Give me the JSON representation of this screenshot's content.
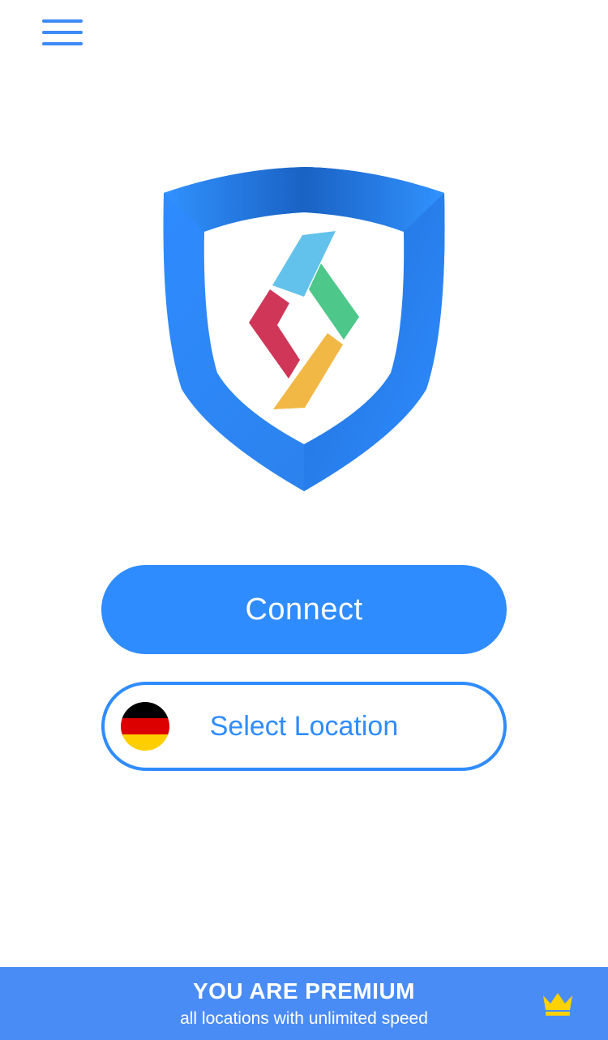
{
  "header": {
    "menu_icon": "hamburger-menu-icon"
  },
  "logo": {
    "icon": "shield-logo-icon",
    "colors": {
      "shield_light": "#3192ff",
      "shield_dark": "#1a62c4",
      "piece_top": "#63c2ec",
      "piece_right": "#4dc78a",
      "piece_left": "#cf3657",
      "piece_bottom": "#f2b845"
    }
  },
  "connect_button": {
    "label": "Connect",
    "color": "#2f8cff"
  },
  "location_button": {
    "label": "Select Location",
    "flag_icon": "germany-flag-icon",
    "flag_colors": [
      "#000000",
      "#dd0000",
      "#ffce00"
    ]
  },
  "premium_banner": {
    "title": "YOU ARE PREMIUM",
    "subtitle": "all locations with unlimited speed",
    "icon": "crown-icon",
    "background": "#4a8cf5",
    "crown_color": "#ffd200"
  }
}
